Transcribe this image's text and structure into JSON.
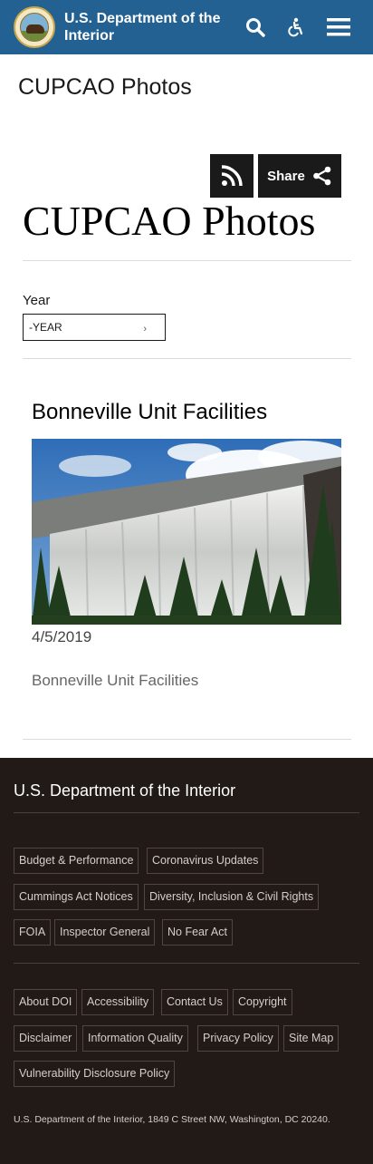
{
  "header": {
    "title": "U.S. Department of the Interior",
    "seal_icon": "doi-seal-bison",
    "search_icon": "search-icon",
    "accessibility_icon": "accessibility-icon",
    "menu_icon": "hamburger-menu-icon",
    "brand_color": "#236192"
  },
  "page": {
    "header_title": "CUPCAO Photos",
    "main_title": "CUPCAO Photos",
    "share_label": "Share",
    "rss_icon": "rss-icon",
    "share_icon": "share-icon"
  },
  "filter": {
    "label": "Year",
    "selected": "-YEAR"
  },
  "card": {
    "title": "Bonneville Unit Facilities",
    "image_description_icon": "dam-spillway-photo",
    "date": "4/5/2019",
    "caption": "Bonneville Unit Facilities"
  },
  "footer": {
    "title": "U.S. Department of the Interior",
    "links_group1": [
      "Budget & Performance",
      "Coronavirus Updates",
      "Cummings Act Notices",
      "Diversity, Inclusion & Civil Rights",
      "FOIA",
      "Inspector General",
      "No Fear Act"
    ],
    "links_group2": [
      "About DOI",
      "Accessibility",
      "Contact Us",
      "Copyright",
      "Disclaimer",
      "Information Quality",
      "Privacy Policy",
      "Site Map",
      "Vulnerability Disclosure Policy"
    ],
    "address": "U.S. Department of the Interior, 1849 C Street NW, Washington, DC 20240.",
    "background_color": "#221a17"
  }
}
